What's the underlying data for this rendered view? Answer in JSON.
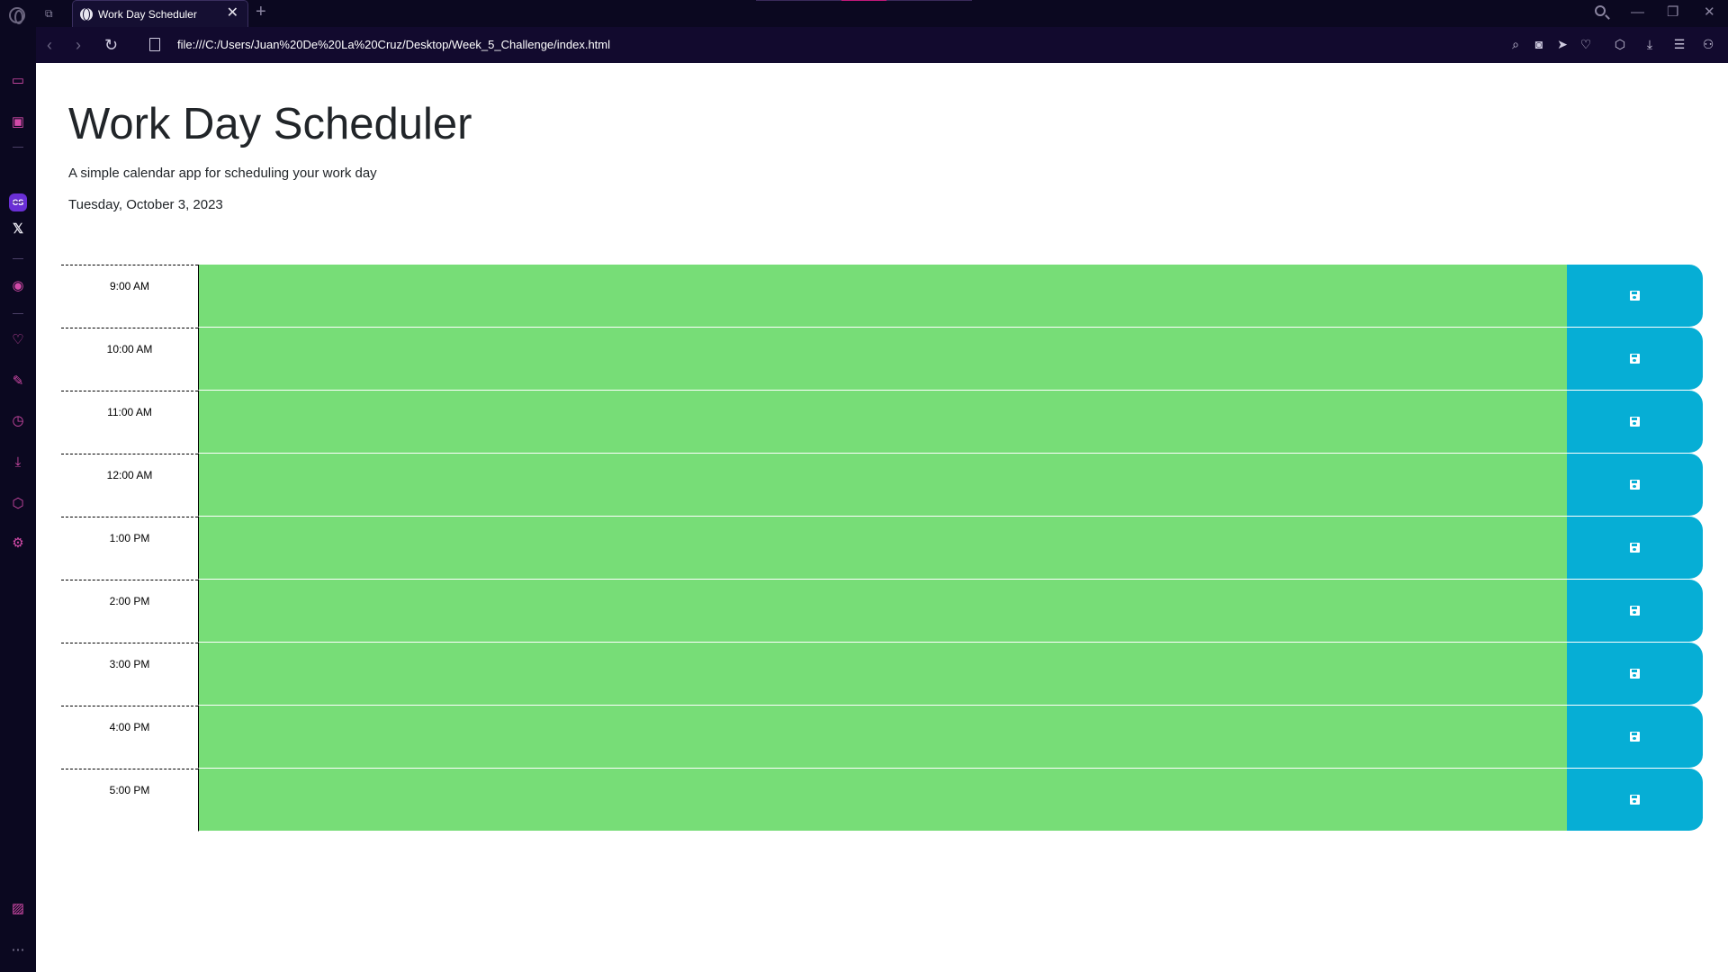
{
  "browser": {
    "tab_title": "Work Day Scheduler",
    "tab_close": "✕",
    "new_tab": "+",
    "url": "file:///C:/Users/Juan%20De%20La%20Cruz/Desktop/Week_5_Challenge/index.html",
    "window_controls": {
      "minimize": "—",
      "restore": "❐",
      "close": "✕"
    }
  },
  "page": {
    "title": "Work Day Scheduler",
    "lead": "A simple calendar app for scheduling your work day",
    "current_day": "Tuesday, October 3, 2023"
  },
  "schedule": {
    "rows": [
      {
        "hour": "9:00 AM",
        "text": "",
        "status": "future"
      },
      {
        "hour": "10:00 AM",
        "text": "",
        "status": "future"
      },
      {
        "hour": "11:00 AM",
        "text": "",
        "status": "future"
      },
      {
        "hour": "12:00 AM",
        "text": "",
        "status": "future"
      },
      {
        "hour": "1:00 PM",
        "text": "",
        "status": "future"
      },
      {
        "hour": "2:00 PM",
        "text": "",
        "status": "future"
      },
      {
        "hour": "3:00 PM",
        "text": "",
        "status": "future"
      },
      {
        "hour": "4:00 PM",
        "text": "",
        "status": "future"
      },
      {
        "hour": "5:00 PM",
        "text": "",
        "status": "future"
      }
    ]
  },
  "colors": {
    "future": "#77dd77",
    "save_button": "#06aed5",
    "chrome_bg": "#0b0820",
    "sidebar_accent": "#d24aa8"
  }
}
